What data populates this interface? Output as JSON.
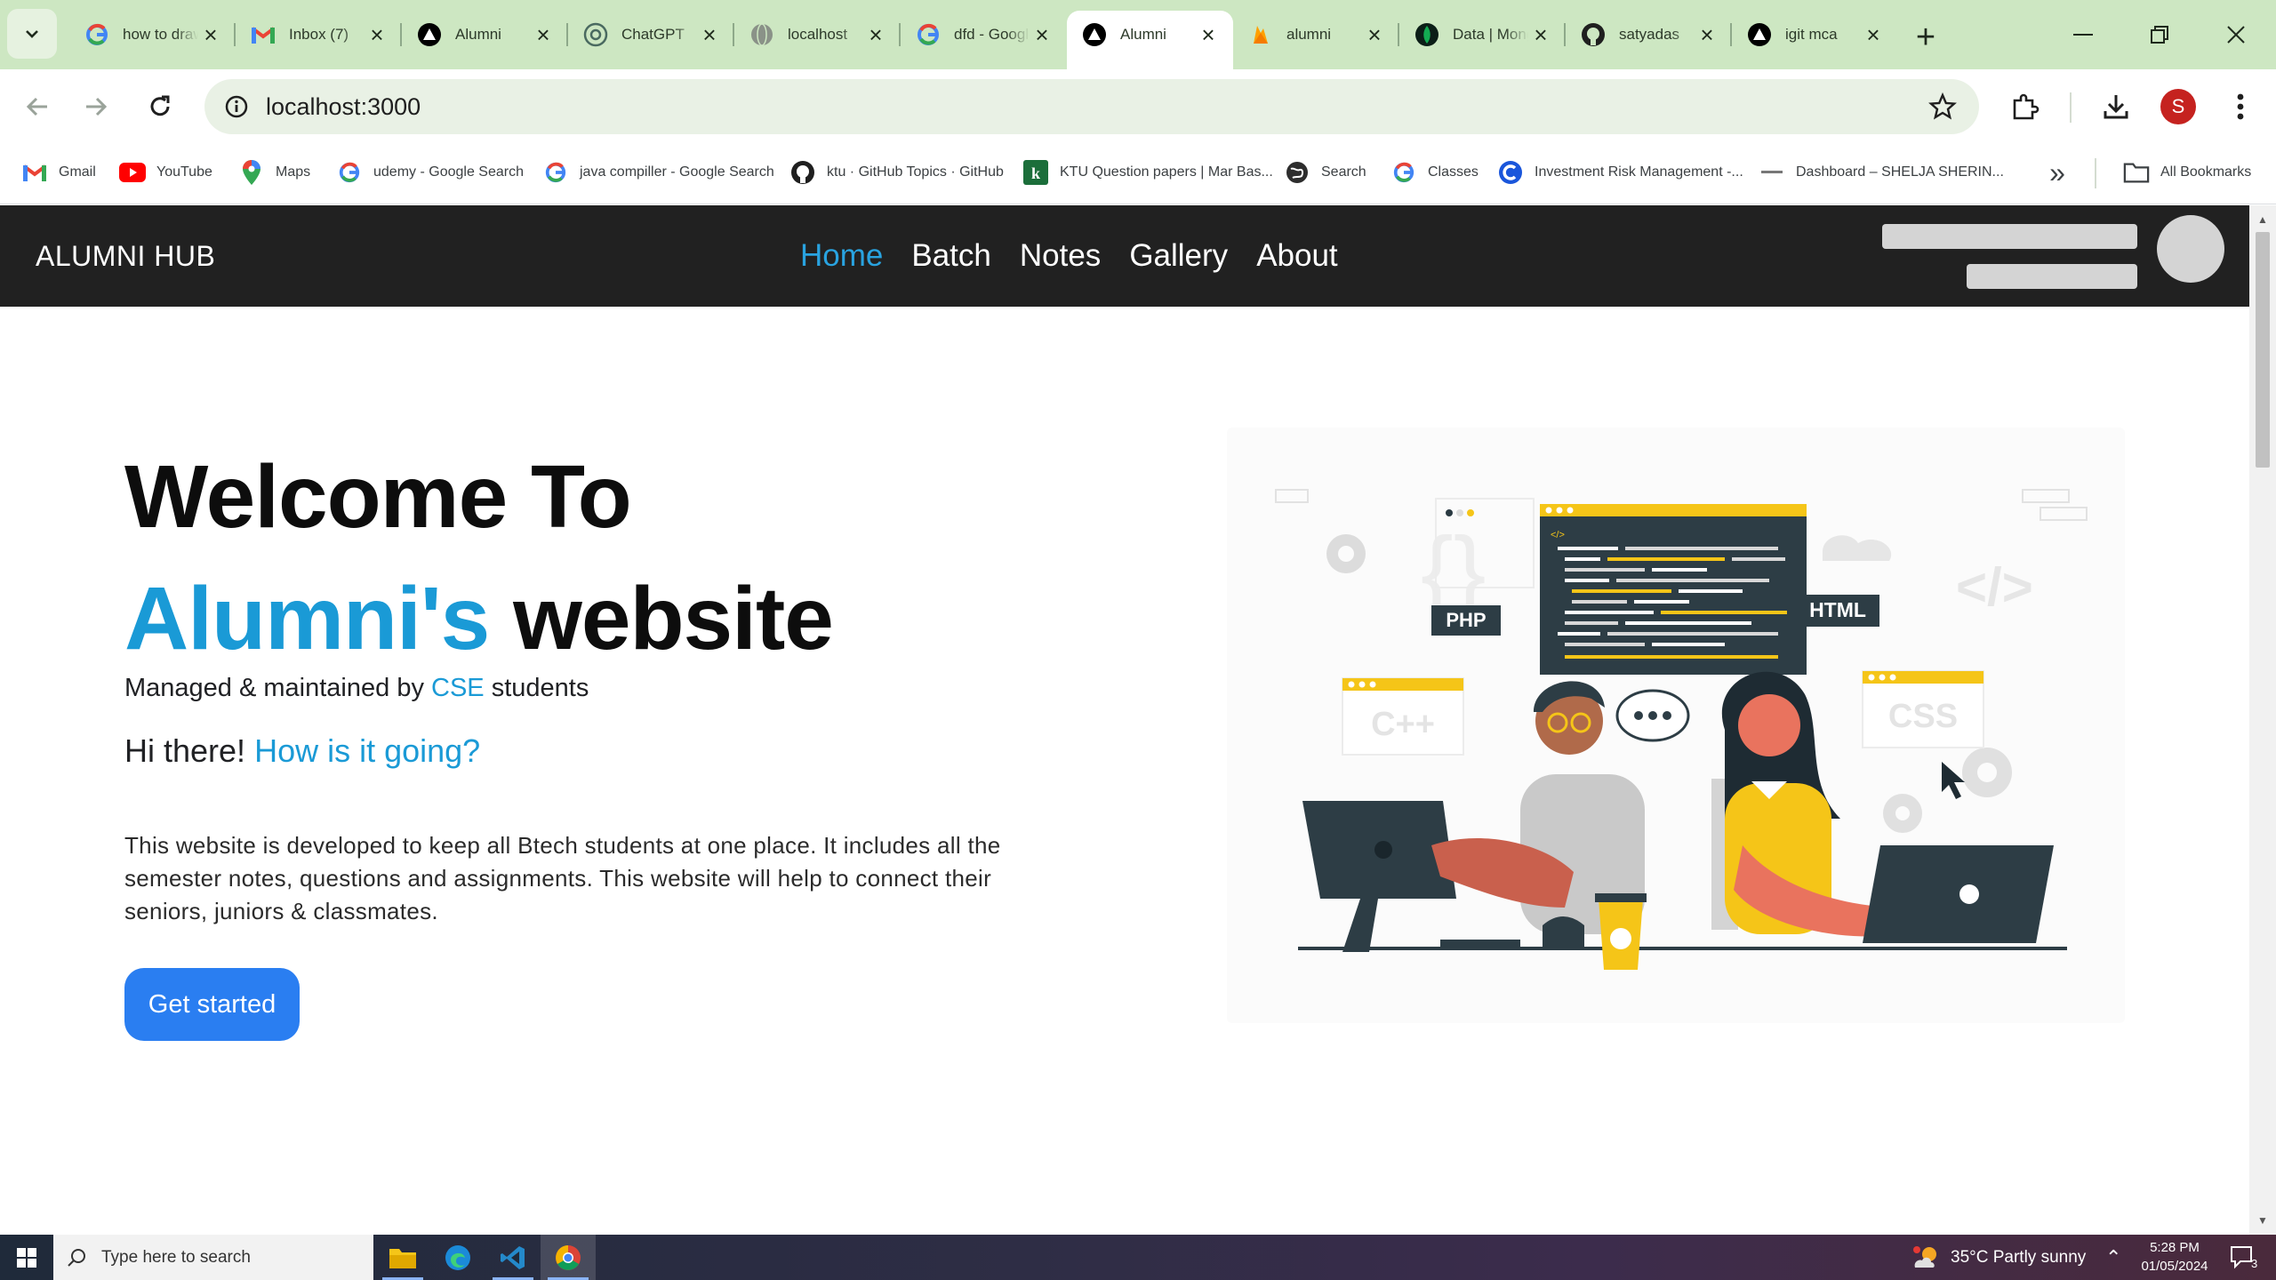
{
  "browser": {
    "tabs": [
      {
        "title": "how to draw",
        "favicon": "google-icon"
      },
      {
        "title": "Inbox (7)",
        "favicon": "gmail-icon"
      },
      {
        "title": "Alumni",
        "favicon": "vercel-icon"
      },
      {
        "title": "ChatGPT",
        "favicon": "chatgpt-icon"
      },
      {
        "title": "localhost",
        "favicon": "globe-icon"
      },
      {
        "title": "dfd - Google",
        "favicon": "google-icon"
      },
      {
        "title": "Alumni",
        "favicon": "vercel-icon",
        "active": true
      },
      {
        "title": "alumni",
        "favicon": "firebase-icon"
      },
      {
        "title": "Data | MongoDB",
        "favicon": "mongodb-icon"
      },
      {
        "title": "satyadas",
        "favicon": "github-icon"
      },
      {
        "title": "igit mca",
        "favicon": "vercel-icon"
      }
    ],
    "url": "localhost:3000",
    "profile_initial": "S"
  },
  "bookmarks": [
    {
      "label": "Gmail",
      "icon": "gmail-icon"
    },
    {
      "label": "YouTube",
      "icon": "youtube-icon"
    },
    {
      "label": "Maps",
      "icon": "maps-icon"
    },
    {
      "label": "udemy - Google Search",
      "icon": "google-icon"
    },
    {
      "label": "java compiller - Google Search",
      "icon": "google-icon"
    },
    {
      "label": "ktu · GitHub Topics · GitHub",
      "icon": "github-icon"
    },
    {
      "label": "KTU Question papers | Mar Bas...",
      "icon": "ktu-icon"
    },
    {
      "label": "Search",
      "icon": "search-globe-icon"
    },
    {
      "label": "Classes",
      "icon": "google-icon"
    },
    {
      "label": "Investment Risk Management -...",
      "icon": "c-icon"
    },
    {
      "label": "Dashboard – SHELJA SHERIN...",
      "icon": "dash-icon"
    }
  ],
  "all_bookmarks_label": "All Bookmarks",
  "site": {
    "brand": "ALUMNI HUB",
    "nav": [
      "Home",
      "Batch",
      "Notes",
      "Gallery",
      "About"
    ],
    "active_nav": "Home",
    "hero": {
      "line1": "Welcome To",
      "line2_accent": "Alumni's",
      "line2_rest": "website",
      "managed_prefix": "Managed & maintained by",
      "managed_accent": "CSE",
      "managed_suffix": "students",
      "greeting": "Hi there!",
      "greeting_accent": "How is it going?",
      "description": "This website is developed to keep all Btech students at one place. It includes all the semester notes, questions and assignments. This website will help to connect their seniors, juniors & classmates.",
      "cta": "Get started"
    },
    "illustration": {
      "php": "PHP",
      "html": "HTML",
      "cpp": "C++",
      "css": "CSS"
    }
  },
  "taskbar": {
    "search_placeholder": "Type here to search",
    "weather": "35°C  Partly sunny",
    "time": "5:28 PM",
    "date": "01/05/2024",
    "notification_count": "3"
  },
  "colors": {
    "accent": "#1a9ad6",
    "nav_active": "#29a3e0",
    "cta": "#2a7ef1",
    "navbar": "#212121",
    "tabstrip": "#cde7c2"
  }
}
